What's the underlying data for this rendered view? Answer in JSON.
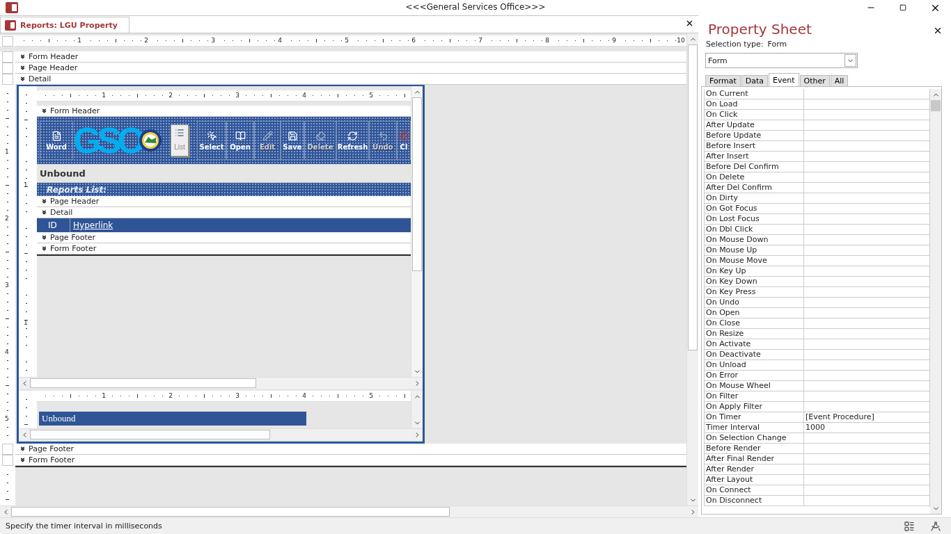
{
  "app_title": "<<<General Services Office>>>",
  "document_tab": {
    "title": "Reports: LGU Property"
  },
  "ruler_numbers": [
    "1",
    "2",
    "3",
    "4",
    "5",
    "6",
    "7",
    "8",
    "9",
    "10"
  ],
  "vertical_ruler_numbers": [
    "1",
    "2",
    "3",
    "4",
    "5"
  ],
  "top_sections": [
    "Form Header",
    "Page Header",
    "Detail"
  ],
  "bottom_sections": [
    "Page Footer",
    "Form Footer"
  ],
  "subform": {
    "ruler_numbers": [
      "1",
      "2",
      "3",
      "4",
      "5"
    ],
    "vertical_ruler_numbers": [
      "1",
      "1"
    ],
    "form_header": "Form Header",
    "toolbar": [
      {
        "kind": "word",
        "label": "Word",
        "disabled": false
      },
      {
        "kind": "logo",
        "label": "GSO"
      },
      {
        "kind": "list",
        "label": "List",
        "disabled": true
      },
      {
        "kind": "select",
        "label": "Select",
        "disabled": false
      },
      {
        "kind": "open",
        "label": "Open",
        "disabled": false
      },
      {
        "kind": "edit",
        "label": "Edit",
        "disabled": true
      },
      {
        "kind": "save",
        "label": "Save",
        "disabled": false
      },
      {
        "kind": "delete",
        "label": "Delete",
        "disabled": true
      },
      {
        "kind": "refresh",
        "label": "Refresh",
        "disabled": false
      },
      {
        "kind": "undo",
        "label": "Undo",
        "disabled": true
      },
      {
        "kind": "close",
        "label": "Cl",
        "disabled": false
      }
    ],
    "unbound_label": "Unbound",
    "list_title": "Reports List:",
    "page_header": "Page Header",
    "detail": "Detail",
    "detail_fields": [
      "ID",
      "Hyperlink"
    ],
    "page_footer": "Page Footer",
    "form_footer": "Form Footer"
  },
  "subform2": {
    "ruler_numbers": [
      "1",
      "2",
      "3",
      "4",
      "5"
    ],
    "field": "Unbound"
  },
  "property_sheet": {
    "title": "Property Sheet",
    "selection_type_label": "Selection type:",
    "selection_type": "Form",
    "object": "Form",
    "tabs": [
      {
        "label": "Format",
        "selected": false
      },
      {
        "label": "Data",
        "selected": false
      },
      {
        "label": "Event",
        "selected": true
      },
      {
        "label": "Other",
        "selected": false
      },
      {
        "label": "All",
        "selected": false
      }
    ],
    "rows": [
      {
        "name": "On Current"
      },
      {
        "name": "On Load"
      },
      {
        "name": "On Click"
      },
      {
        "name": "After Update"
      },
      {
        "name": "Before Update"
      },
      {
        "name": "Before Insert"
      },
      {
        "name": "After Insert"
      },
      {
        "name": "Before Del Confirm"
      },
      {
        "name": "On Delete"
      },
      {
        "name": "After Del Confirm"
      },
      {
        "name": "On Dirty"
      },
      {
        "name": "On Got Focus"
      },
      {
        "name": "On Lost Focus"
      },
      {
        "name": "On Dbl Click"
      },
      {
        "name": "On Mouse Down"
      },
      {
        "name": "On Mouse Up"
      },
      {
        "name": "On Mouse Move"
      },
      {
        "name": "On Key Up"
      },
      {
        "name": "On Key Down"
      },
      {
        "name": "On Key Press"
      },
      {
        "name": "On Undo"
      },
      {
        "name": "On Open"
      },
      {
        "name": "On Close"
      },
      {
        "name": "On Resize"
      },
      {
        "name": "On Activate"
      },
      {
        "name": "On Deactivate"
      },
      {
        "name": "On Unload"
      },
      {
        "name": "On Error"
      },
      {
        "name": "On Mouse Wheel"
      },
      {
        "name": "On Filter"
      },
      {
        "name": "On Apply Filter"
      },
      {
        "name": "On Timer",
        "value": "[Event Procedure]"
      },
      {
        "name": "Timer Interval",
        "value": "1000"
      },
      {
        "name": "On Selection Change"
      },
      {
        "name": "Before Render"
      },
      {
        "name": "After Final Render"
      },
      {
        "name": "After Render"
      },
      {
        "name": "After Layout"
      },
      {
        "name": "On Connect"
      },
      {
        "name": "On Disconnect"
      }
    ]
  },
  "status_bar": {
    "text": "Specify the timer interval in milliseconds"
  }
}
